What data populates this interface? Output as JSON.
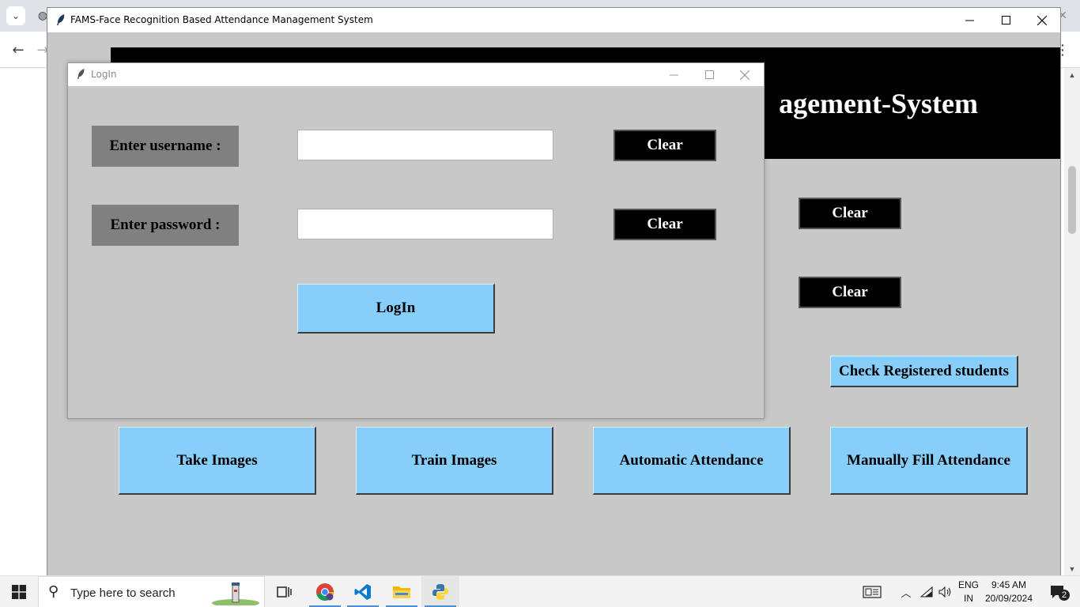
{
  "main_window": {
    "title": "FAMS-Face Recognition Based Attendance Management System",
    "header_text": "agement-System",
    "right_clear_buttons": [
      "Clear",
      "Clear"
    ],
    "check_registered_label": "Check Registered students",
    "bottom_buttons": [
      "Take Images",
      "Train Images",
      "Automatic Attendance",
      "Manually Fill Attendance"
    ]
  },
  "login_dialog": {
    "title": "LogIn",
    "username_label": "Enter username :",
    "username_value": "",
    "password_label": "Enter password :",
    "password_value": "",
    "clear_username_label": "Clear",
    "clear_password_label": "Clear",
    "login_button_label": "LogIn"
  },
  "taskbar": {
    "search_placeholder": "Type here to search",
    "lang_line1": "ENG",
    "lang_line2": "IN",
    "time": "9:45 AM",
    "date": "20/09/2024",
    "notification_count": "2"
  },
  "colors": {
    "window_bg": "#c8c8c8",
    "header_bg": "#000000",
    "button_blue": "#87cefa",
    "label_grey": "#808080"
  },
  "icons": [
    "chevron-down-icon",
    "back-arrow-icon",
    "forward-arrow-icon",
    "feather-icon",
    "minimize-icon",
    "maximize-icon",
    "close-icon",
    "windows-start-icon",
    "search-icon",
    "task-view-icon",
    "chrome-icon",
    "vscode-icon",
    "file-explorer-icon",
    "python-icon",
    "news-icon",
    "chevron-up-icon",
    "network-icon",
    "volume-icon",
    "notifications-icon"
  ]
}
